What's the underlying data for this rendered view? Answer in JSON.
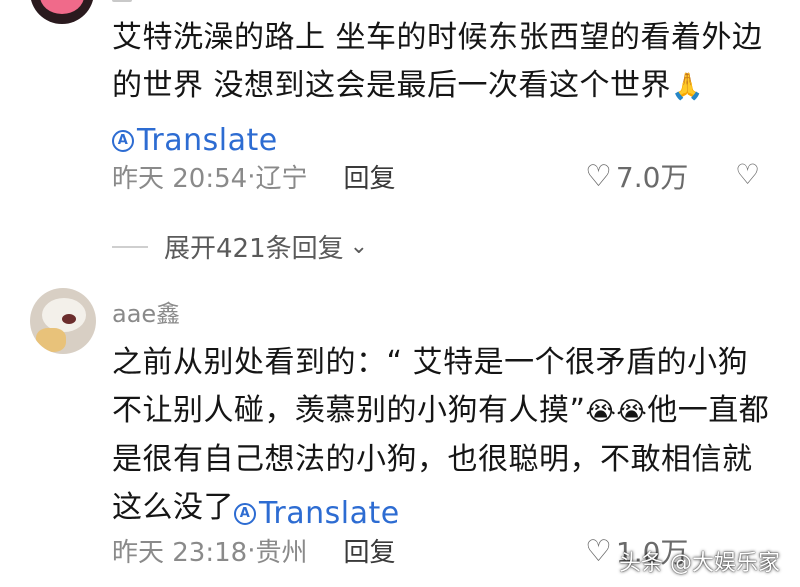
{
  "comments": [
    {
      "text": "艾特洗澡的路上 坐车的时候东张西望的看着外边的世界 没想到这会是最后一次看这个世界",
      "emoji": "🙏",
      "translate_label": "Translate",
      "time": "昨天 20:54",
      "location": "辽宁",
      "reply_label": "回复",
      "likes": "7.0万"
    },
    {
      "username": "aae鑫",
      "text_part1": "之前从别处看到的：“ 艾特是一个很矛盾的小狗  不让别人碰，羡慕别的小狗有人摸”",
      "emoji": "😭😭",
      "text_part2": "他一直都是很有自己想法的小狗，也很聪明，不敢相信就这么没了",
      "translate_label": "Translate",
      "time": "昨天 23:18",
      "location": "贵州",
      "reply_label": "回复",
      "likes": "1.0万"
    }
  ],
  "expand": {
    "label": "展开421条回复"
  },
  "watermark": "头条 @大娱乐家",
  "colors": {
    "link": "#2d6cd2",
    "meta": "#8a8a8a",
    "text": "#151515"
  },
  "icons": {
    "translate": "translate-icon",
    "like": "heart-outline-icon",
    "dislike": "broken-heart-icon",
    "expand": "chevron-down-icon"
  }
}
